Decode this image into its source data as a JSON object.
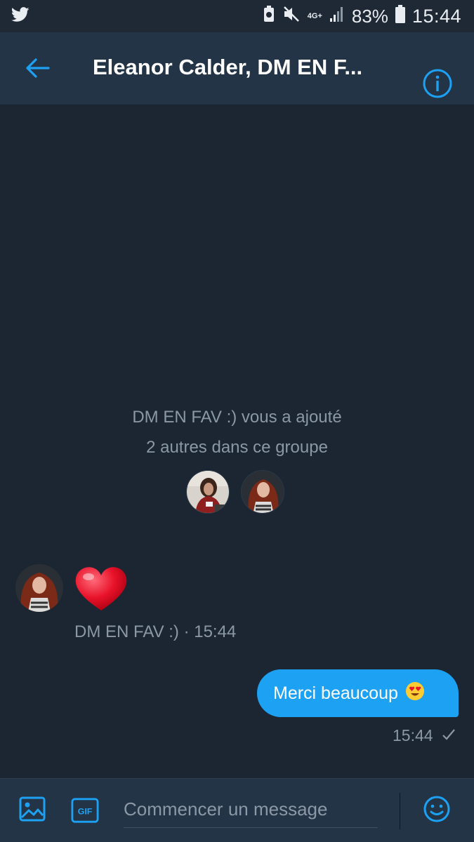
{
  "status_bar": {
    "app_icon": "twitter-bird-icon",
    "network": "4G+",
    "battery_percent": "83%",
    "time": "15:44"
  },
  "header": {
    "title": "Eleanor Calder, DM EN F...",
    "back_icon": "arrow-left-icon",
    "info_icon": "info-icon"
  },
  "system_message": {
    "line1": "DM EN FAV :) vous a ajouté",
    "line2": "2 autres dans ce groupe"
  },
  "incoming_message": {
    "content": "heart-emoji",
    "meta": "DM EN FAV :) · 15:44"
  },
  "outgoing_message": {
    "text": "Merci beaucoup",
    "emoji": "😍",
    "time": "15:44"
  },
  "composer": {
    "placeholder": "Commencer un message",
    "gif_label": "GIF"
  },
  "colors": {
    "background": "#1c2632",
    "header": "#243447",
    "accent": "#1da1f2",
    "muted_text": "#8b98a5"
  }
}
